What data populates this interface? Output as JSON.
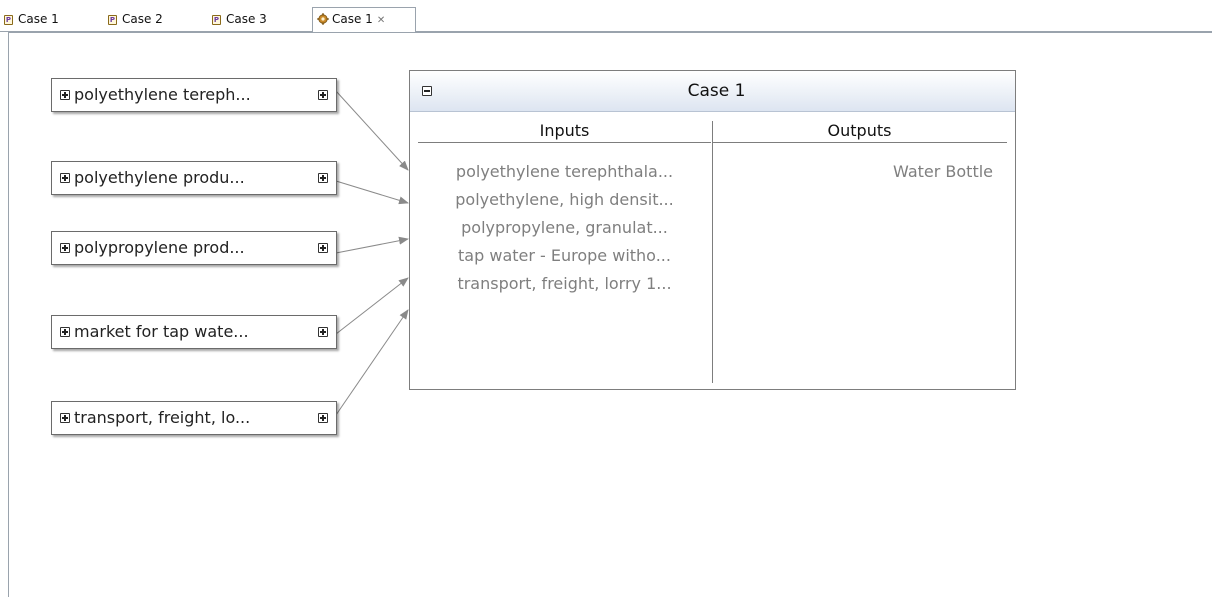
{
  "tabs": [
    {
      "label": "Case 1",
      "icon": "process-icon",
      "active": false
    },
    {
      "label": "Case 2",
      "icon": "process-icon",
      "active": false
    },
    {
      "label": "Case 3",
      "icon": "process-icon",
      "active": false
    },
    {
      "label": "Case 1",
      "icon": "graph-gear-icon",
      "active": true,
      "close": "✕"
    }
  ],
  "tab_icon_glyph": "P",
  "providers": [
    {
      "label": "polyethylene tereph..."
    },
    {
      "label": "polyethylene produ..."
    },
    {
      "label": "polypropylene prod..."
    },
    {
      "label": "market for tap wate..."
    },
    {
      "label": "transport, freight, lo..."
    }
  ],
  "process": {
    "title": "Case 1",
    "inputs_header": "Inputs",
    "outputs_header": "Outputs",
    "inputs": [
      "polyethylene terephthala...",
      "polyethylene, high densit...",
      "polypropylene, granulat...",
      "tap water - Europe witho...",
      "transport, freight, lorry 1..."
    ],
    "outputs": [
      "Water Bottle"
    ]
  },
  "colors": {
    "text_muted": "#7f7f7f",
    "header_gradient_end": "#dde5f1",
    "border": "#7d7d7d",
    "wire": "#8a8a8a"
  }
}
